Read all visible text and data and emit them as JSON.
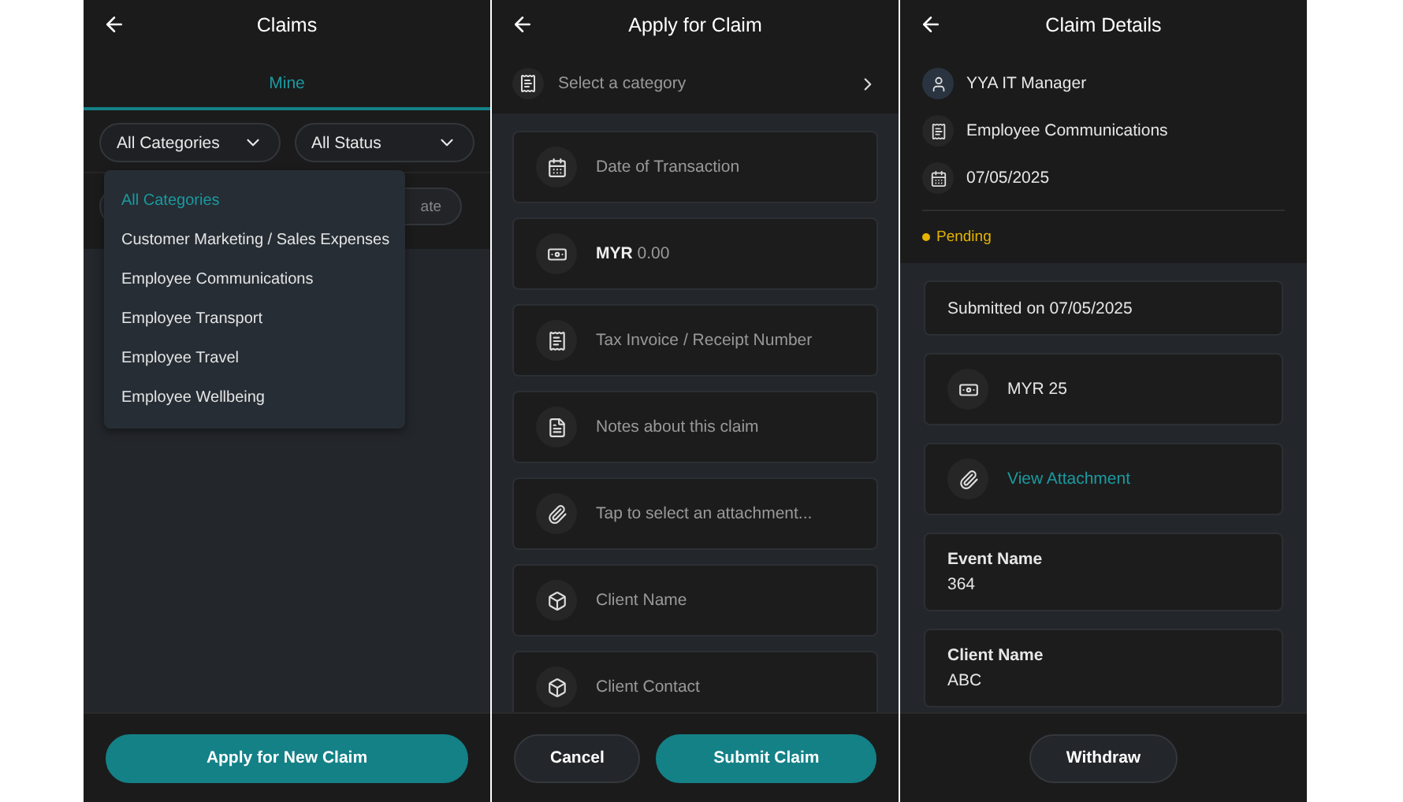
{
  "claims_list": {
    "title": "Claims",
    "tabs": [
      {
        "label": "Mine",
        "selected": true
      }
    ],
    "filters": [
      {
        "label": "All Categories"
      },
      {
        "label": "All Status"
      }
    ],
    "covered_field_text": "ate",
    "category_menu": [
      {
        "label": "All Categories",
        "selected": true
      },
      {
        "label": "Customer Marketing / Sales Expenses",
        "selected": false
      },
      {
        "label": "Employee Communications",
        "selected": false
      },
      {
        "label": "Employee Transport",
        "selected": false
      },
      {
        "label": "Employee Travel",
        "selected": false
      },
      {
        "label": "Employee Wellbeing",
        "selected": false
      }
    ],
    "buttons": [
      {
        "label": "Apply for New Claim",
        "kind": "primary"
      }
    ]
  },
  "apply_form": {
    "title": "Apply for Claim",
    "category": {
      "placeholder": "Select a category"
    },
    "fields": [
      {
        "kind": "date",
        "placeholder": "Date of Transaction"
      },
      {
        "kind": "amount",
        "currency": "MYR",
        "placeholder": "0.00"
      },
      {
        "kind": "receipt",
        "placeholder": "Tax Invoice / Receipt Number"
      },
      {
        "kind": "notes",
        "placeholder": "Notes about this claim"
      },
      {
        "kind": "attachment",
        "placeholder": "Tap to select an attachment..."
      },
      {
        "kind": "client",
        "placeholder": "Client Name"
      },
      {
        "kind": "client",
        "placeholder": "Client Contact"
      }
    ],
    "buttons": [
      {
        "label": "Cancel",
        "kind": "secondary"
      },
      {
        "label": "Submit Claim",
        "kind": "primary"
      }
    ]
  },
  "claim_details": {
    "title": "Claim Details",
    "info": [
      {
        "kind": "person",
        "text": "YYA IT Manager"
      },
      {
        "kind": "category",
        "text": "Employee Communications"
      },
      {
        "kind": "date",
        "text": "07/05/2025"
      }
    ],
    "status": {
      "kind": "pending",
      "label": "Pending"
    },
    "cards": [
      {
        "kind": "text",
        "text": "Submitted on 07/05/2025"
      },
      {
        "kind": "amount",
        "text": "MYR 25"
      },
      {
        "kind": "link",
        "text": "View Attachment"
      },
      {
        "kind": "field",
        "label": "Event Name",
        "value": "364"
      },
      {
        "kind": "field",
        "label": "Client Name",
        "value": "ABC"
      }
    ],
    "buttons": [
      {
        "label": "Withdraw",
        "kind": "secondary"
      }
    ]
  }
}
